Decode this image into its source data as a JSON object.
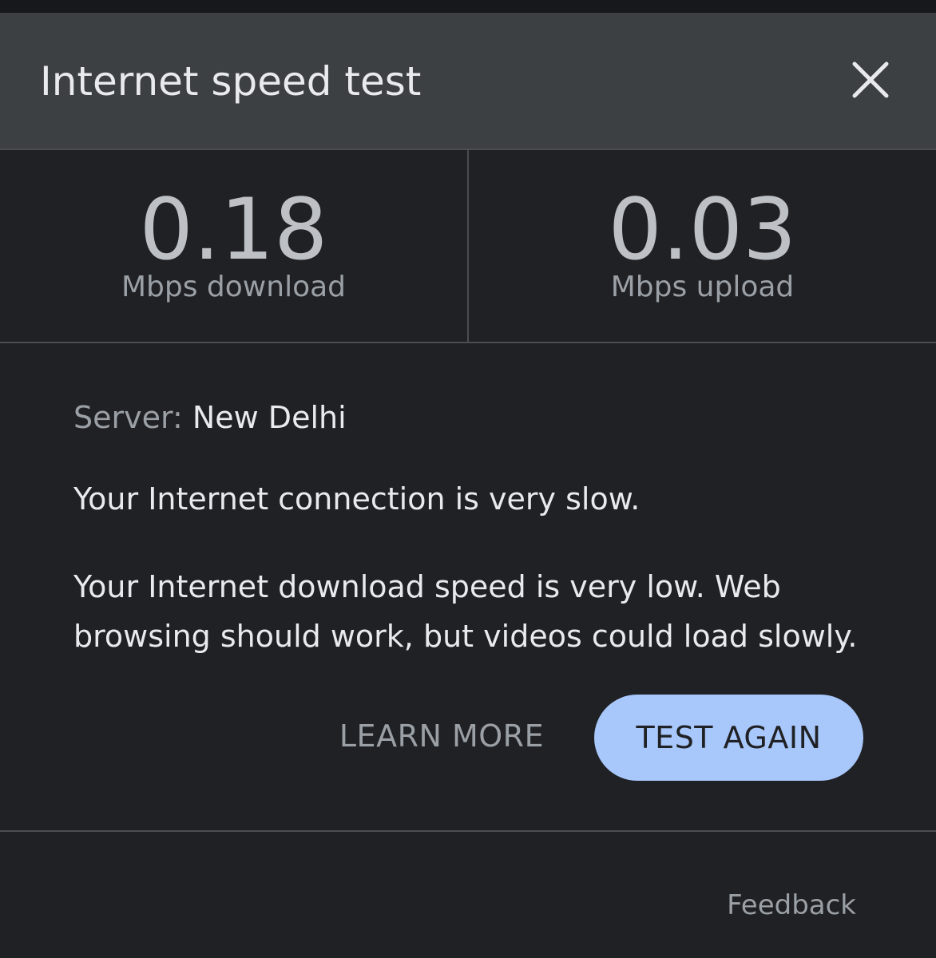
{
  "header": {
    "title": "Internet speed test",
    "close_icon": "close-icon"
  },
  "stats": {
    "download": {
      "value": "0.18",
      "unit": "Mbps download"
    },
    "upload": {
      "value": "0.03",
      "unit": "Mbps upload"
    }
  },
  "content": {
    "server_label": "Server:",
    "server_value": "New Delhi",
    "status": "Your Internet connection is very slow.",
    "details": "Your Internet download speed is very low. Web browsing should work, but videos could load slowly."
  },
  "actions": {
    "learn_more": "LEARN MORE",
    "test_again": "TEST AGAIN"
  },
  "footer": {
    "feedback": "Feedback"
  },
  "colors": {
    "header_bg": "#3c4043",
    "panel_bg": "#202124",
    "accent_button": "#a8c7fa",
    "primary_text": "#e8eaed",
    "secondary_text": "#9aa0a6"
  }
}
